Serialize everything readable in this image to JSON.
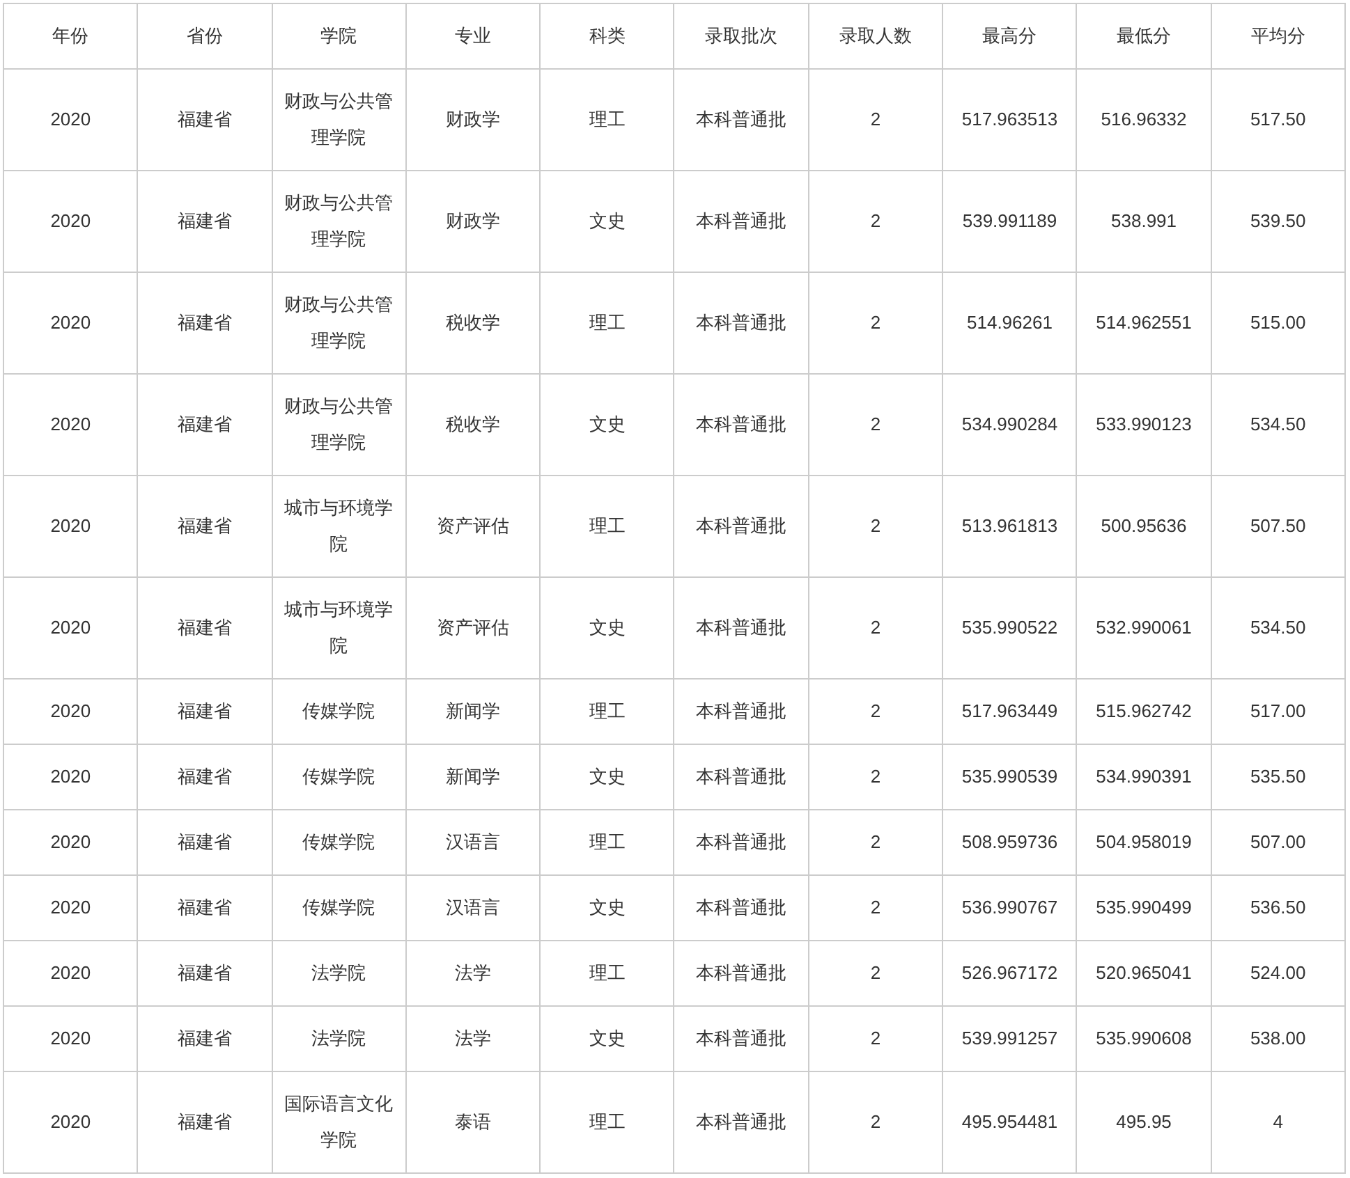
{
  "table": {
    "columns": [
      "年份",
      "省份",
      "学院",
      "专业",
      "科类",
      "录取批次",
      "录取人数",
      "最高分",
      "最低分",
      "平均分"
    ],
    "rows": [
      [
        "2020",
        "福建省",
        "财政与公共管理学院",
        "财政学",
        "理工",
        "本科普通批",
        "2",
        "517.963513",
        "516.96332",
        "517.50"
      ],
      [
        "2020",
        "福建省",
        "财政与公共管理学院",
        "财政学",
        "文史",
        "本科普通批",
        "2",
        "539.991189",
        "538.991",
        "539.50"
      ],
      [
        "2020",
        "福建省",
        "财政与公共管理学院",
        "税收学",
        "理工",
        "本科普通批",
        "2",
        "514.96261",
        "514.962551",
        "515.00"
      ],
      [
        "2020",
        "福建省",
        "财政与公共管理学院",
        "税收学",
        "文史",
        "本科普通批",
        "2",
        "534.990284",
        "533.990123",
        "534.50"
      ],
      [
        "2020",
        "福建省",
        "城市与环境学院",
        "资产评估",
        "理工",
        "本科普通批",
        "2",
        "513.961813",
        "500.95636",
        "507.50"
      ],
      [
        "2020",
        "福建省",
        "城市与环境学院",
        "资产评估",
        "文史",
        "本科普通批",
        "2",
        "535.990522",
        "532.990061",
        "534.50"
      ],
      [
        "2020",
        "福建省",
        "传媒学院",
        "新闻学",
        "理工",
        "本科普通批",
        "2",
        "517.963449",
        "515.962742",
        "517.00"
      ],
      [
        "2020",
        "福建省",
        "传媒学院",
        "新闻学",
        "文史",
        "本科普通批",
        "2",
        "535.990539",
        "534.990391",
        "535.50"
      ],
      [
        "2020",
        "福建省",
        "传媒学院",
        "汉语言",
        "理工",
        "本科普通批",
        "2",
        "508.959736",
        "504.958019",
        "507.00"
      ],
      [
        "2020",
        "福建省",
        "传媒学院",
        "汉语言",
        "文史",
        "本科普通批",
        "2",
        "536.990767",
        "535.990499",
        "536.50"
      ],
      [
        "2020",
        "福建省",
        "法学院",
        "法学",
        "理工",
        "本科普通批",
        "2",
        "526.967172",
        "520.965041",
        "524.00"
      ],
      [
        "2020",
        "福建省",
        "法学院",
        "法学",
        "文史",
        "本科普通批",
        "2",
        "539.991257",
        "535.990608",
        "538.00"
      ],
      [
        "2020",
        "福建省",
        "国际语言文化学院",
        "泰语",
        "理工",
        "本科普通批",
        "2",
        "495.954481",
        "495.95",
        "4"
      ]
    ]
  }
}
